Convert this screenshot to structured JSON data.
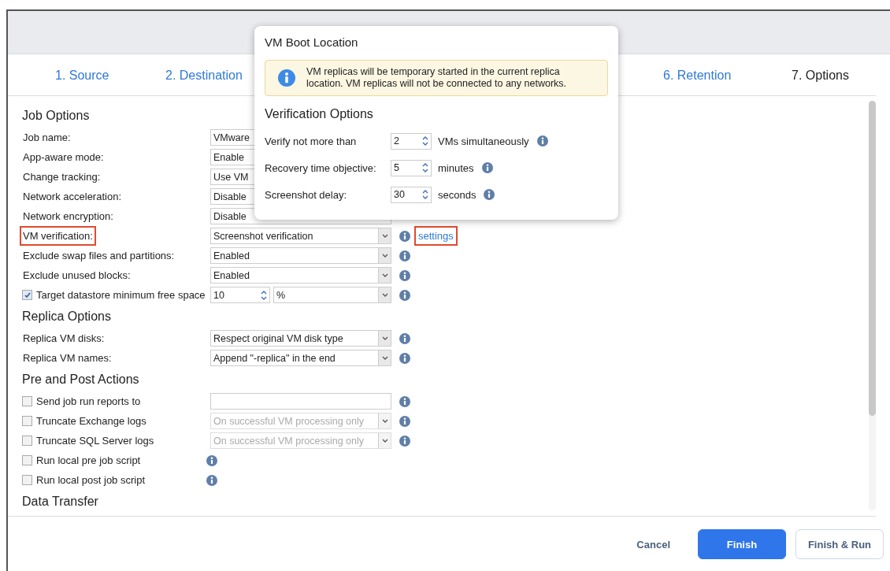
{
  "tabs": [
    {
      "label": "1. Source",
      "selected": false
    },
    {
      "label": "2. Destination",
      "selected": false
    },
    {
      "label": "6. Retention",
      "selected": false
    },
    {
      "label": "7. Options",
      "selected": true
    }
  ],
  "sections": [
    {
      "title": "Job Options",
      "rows": [
        {
          "label": "Job name:",
          "kind": "input",
          "value": "VMware"
        },
        {
          "label": "App-aware mode:",
          "kind": "input",
          "value": "Enable"
        },
        {
          "label": "Change tracking:",
          "kind": "input",
          "value": "Use VM"
        },
        {
          "label": "Network acceleration:",
          "kind": "input",
          "value": "Disable"
        },
        {
          "label": "Network encryption:",
          "kind": "input",
          "value": "Disable"
        },
        {
          "label": "VM verification:",
          "kind": "select",
          "value": "Screenshot verification",
          "info": true,
          "highlighted": true,
          "link": "settings"
        },
        {
          "label": "Exclude swap files and partitions:",
          "kind": "select",
          "value": "Enabled",
          "info": true,
          "highlighted": false
        },
        {
          "label": "Exclude unused blocks:",
          "kind": "select",
          "value": "Enabled",
          "info": true,
          "highlighted": false
        },
        {
          "label": "Target datastore minimum free space",
          "checked": true,
          "kind": "spinner_select",
          "value": "10",
          "unit": "%",
          "info": true,
          "highlighted": false
        }
      ]
    },
    {
      "title": "Replica Options",
      "rows": [
        {
          "label": "Replica VM disks:",
          "kind": "select",
          "value": "Respect original VM disk type",
          "info": true,
          "highlighted": false
        },
        {
          "label": "Replica VM names:",
          "kind": "select",
          "value": "Append \"-replica\" in the end",
          "info": true,
          "highlighted": false
        }
      ]
    },
    {
      "title": "Pre and Post Actions",
      "rows": [
        {
          "label": "Send job run reports to",
          "checked": false,
          "kind": "input",
          "info": true
        },
        {
          "label": "Truncate Exchange logs",
          "checked": false,
          "kind": "select",
          "value": "On successful VM processing only",
          "disabled": true,
          "info": true
        },
        {
          "label": "Truncate SQL Server logs",
          "checked": false,
          "kind": "select",
          "value": "On successful VM processing only",
          "disabled": true,
          "info": true
        },
        {
          "label": "Run local pre job script",
          "checked": false,
          "kind": "none",
          "info": true
        },
        {
          "label": "Run local post job script",
          "checked": false,
          "kind": "none",
          "info": true
        }
      ]
    },
    {
      "title": "Data Transfer"
    }
  ],
  "popup": {
    "title": "VM Boot Location",
    "notice": "VM replicas will be temporary started in the current replica location. VM replicas will not be connected to any networks.",
    "section": "Verification Options",
    "rows": [
      {
        "label": "Verify not more than",
        "value": "2",
        "unit": "VMs simultaneously"
      },
      {
        "label": "Recovery time objective:",
        "value": "5",
        "unit": "minutes"
      },
      {
        "label": "Screenshot delay:",
        "value": "30",
        "unit": "seconds"
      }
    ]
  },
  "buttons": [
    {
      "label": "Cancel",
      "kind": "link"
    },
    {
      "label": "Finish",
      "kind": "primary"
    },
    {
      "label": "Finish & Run",
      "kind": "secondary"
    }
  ]
}
